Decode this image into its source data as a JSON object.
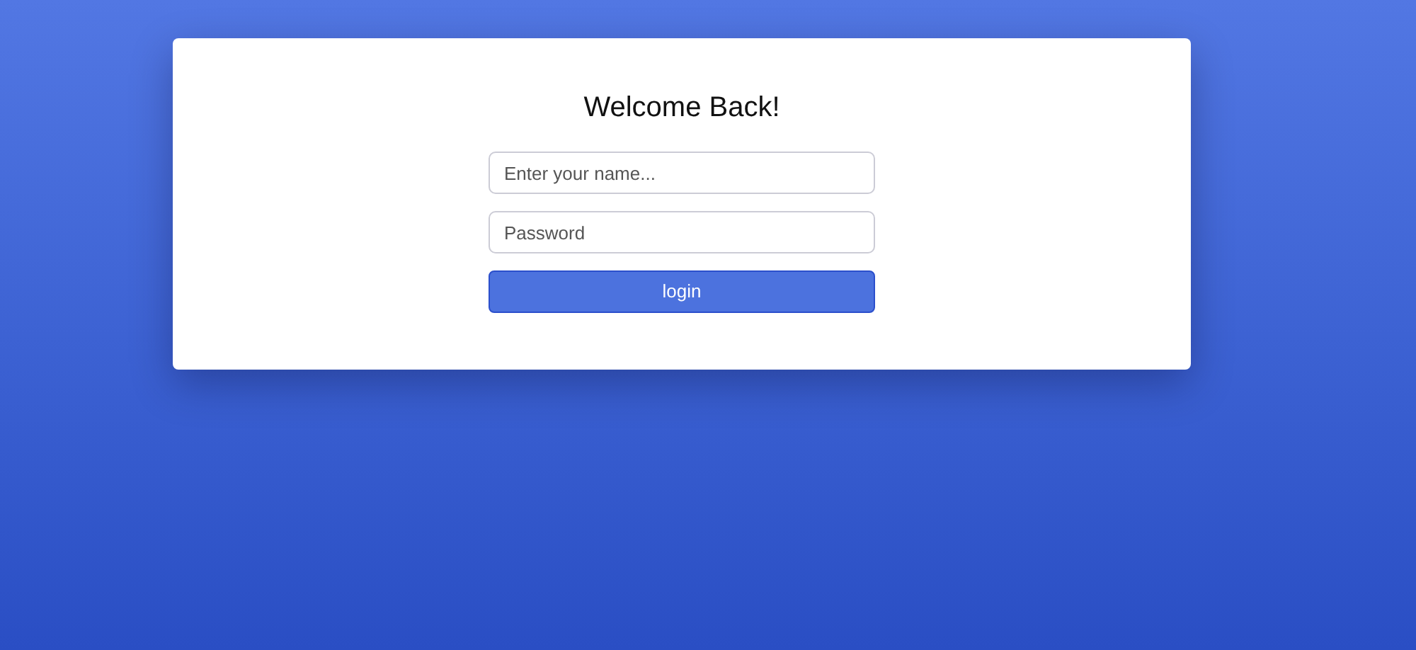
{
  "card": {
    "title": "Welcome Back!",
    "fields": [
      {
        "placeholder": "Enter your name..."
      },
      {
        "placeholder": "Password"
      }
    ],
    "button": "login"
  }
}
